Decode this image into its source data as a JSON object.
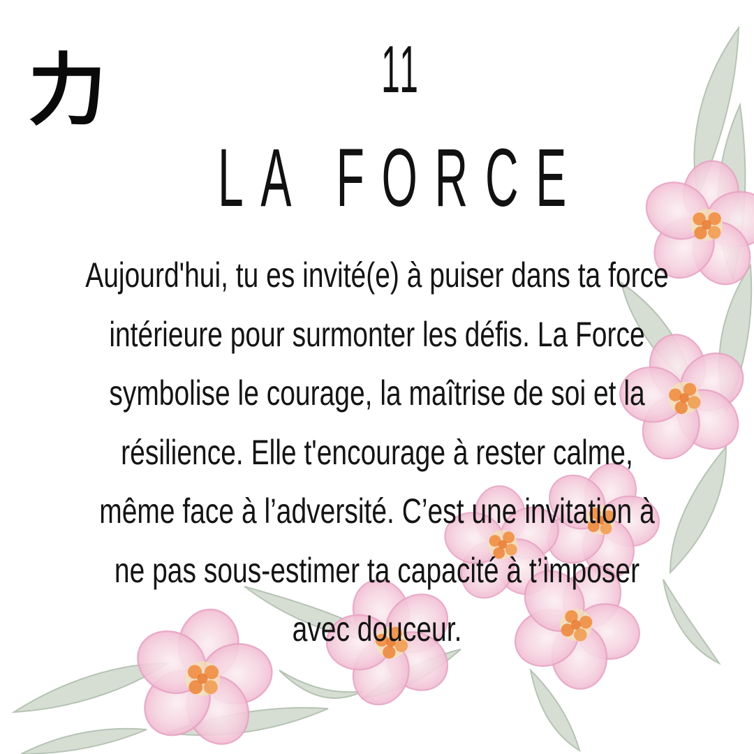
{
  "card": {
    "kanji": "力",
    "number": "11",
    "title": "LA FORCE",
    "description_lines": [
      "Aujourd'hui, tu es invité(e) à puiser dans ta force",
      "intérieure pour surmonter les défis. La Force",
      "symbolise le courage, la maîtrise de soi et la",
      "résilience. Elle t'encourage à rester calme,",
      "même face à l’adversité. C’est une invitation à",
      "ne pas sous-estimer ta capacité à t’imposer",
      "avec douceur."
    ]
  },
  "decoration": {
    "icon": "watercolor-pink-flowers-and-leaves",
    "petal_color": "#f3c6d8",
    "petal_edge_color": "#e79ec0",
    "center_color": "#ee8a3c",
    "leaf_color": "#cfd9cd"
  },
  "colors": {
    "background": "#ffffff",
    "text": "#111111"
  }
}
